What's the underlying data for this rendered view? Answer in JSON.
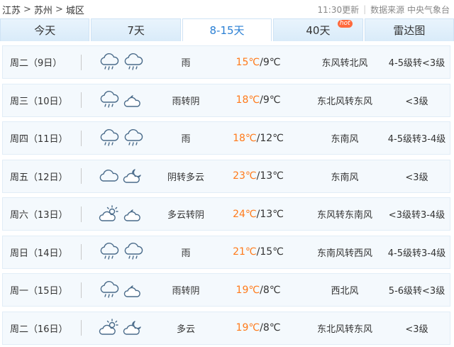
{
  "breadcrumb": [
    "江苏",
    "苏州",
    "城区"
  ],
  "breadcrumb_sep": ">",
  "update_time": "11:30更新",
  "source": "数据来源 中央气象台",
  "tabs": [
    {
      "label": "今天",
      "active": false,
      "badge": ""
    },
    {
      "label": "7天",
      "active": false,
      "badge": ""
    },
    {
      "label": "8-15天",
      "active": true,
      "badge": ""
    },
    {
      "label": "40天",
      "active": false,
      "badge": "hot"
    },
    {
      "label": "雷达图",
      "active": false,
      "badge": ""
    }
  ],
  "colors": {
    "high_temp": "#ff7a1a",
    "active_tab": "#2a7fd4",
    "hot_badge": "#ff6a3d"
  },
  "forecast": [
    {
      "day": "周二（9日）",
      "icons": [
        "rain-cloud-icon",
        "rain-cloud-icon"
      ],
      "condition": "雨",
      "high": "15℃",
      "low": "9℃",
      "wind": "东风转北风",
      "level": "4-5级转<3级"
    },
    {
      "day": "周三（10日）",
      "icons": [
        "rain-cloud-icon",
        "cloud-night-icon"
      ],
      "condition": "雨转阴",
      "high": "18℃",
      "low": "9℃",
      "wind": "东北风转东风",
      "level": "<3级"
    },
    {
      "day": "周四（11日）",
      "icons": [
        "rain-cloud-icon",
        "rain-cloud-icon"
      ],
      "condition": "雨",
      "high": "18℃",
      "low": "12℃",
      "wind": "东南风",
      "level": "4-5级转3-4级"
    },
    {
      "day": "周五（12日）",
      "icons": [
        "cloud-icon",
        "cloud-moon-icon"
      ],
      "condition": "阴转多云",
      "high": "23℃",
      "low": "13℃",
      "wind": "东南风",
      "level": "<3级"
    },
    {
      "day": "周六（13日）",
      "icons": [
        "sun-cloud-icon",
        "cloud-night-icon"
      ],
      "condition": "多云转阴",
      "high": "24℃",
      "low": "13℃",
      "wind": "东风转东南风",
      "level": "<3级转3-4级"
    },
    {
      "day": "周日（14日）",
      "icons": [
        "rain-cloud-icon",
        "rain-cloud-icon"
      ],
      "condition": "雨",
      "high": "21℃",
      "low": "15℃",
      "wind": "东南风转西风",
      "level": "4-5级转3-4级"
    },
    {
      "day": "周一（15日）",
      "icons": [
        "rain-cloud-icon",
        "cloud-night-icon"
      ],
      "condition": "雨转阴",
      "high": "19℃",
      "low": "8℃",
      "wind": "西北风",
      "level": "5-6级转<3级"
    },
    {
      "day": "周二（16日）",
      "icons": [
        "sun-cloud-icon",
        "cloud-moon-icon"
      ],
      "condition": "多云",
      "high": "19℃",
      "low": "8℃",
      "wind": "东北风转东风",
      "level": "<3级"
    }
  ]
}
